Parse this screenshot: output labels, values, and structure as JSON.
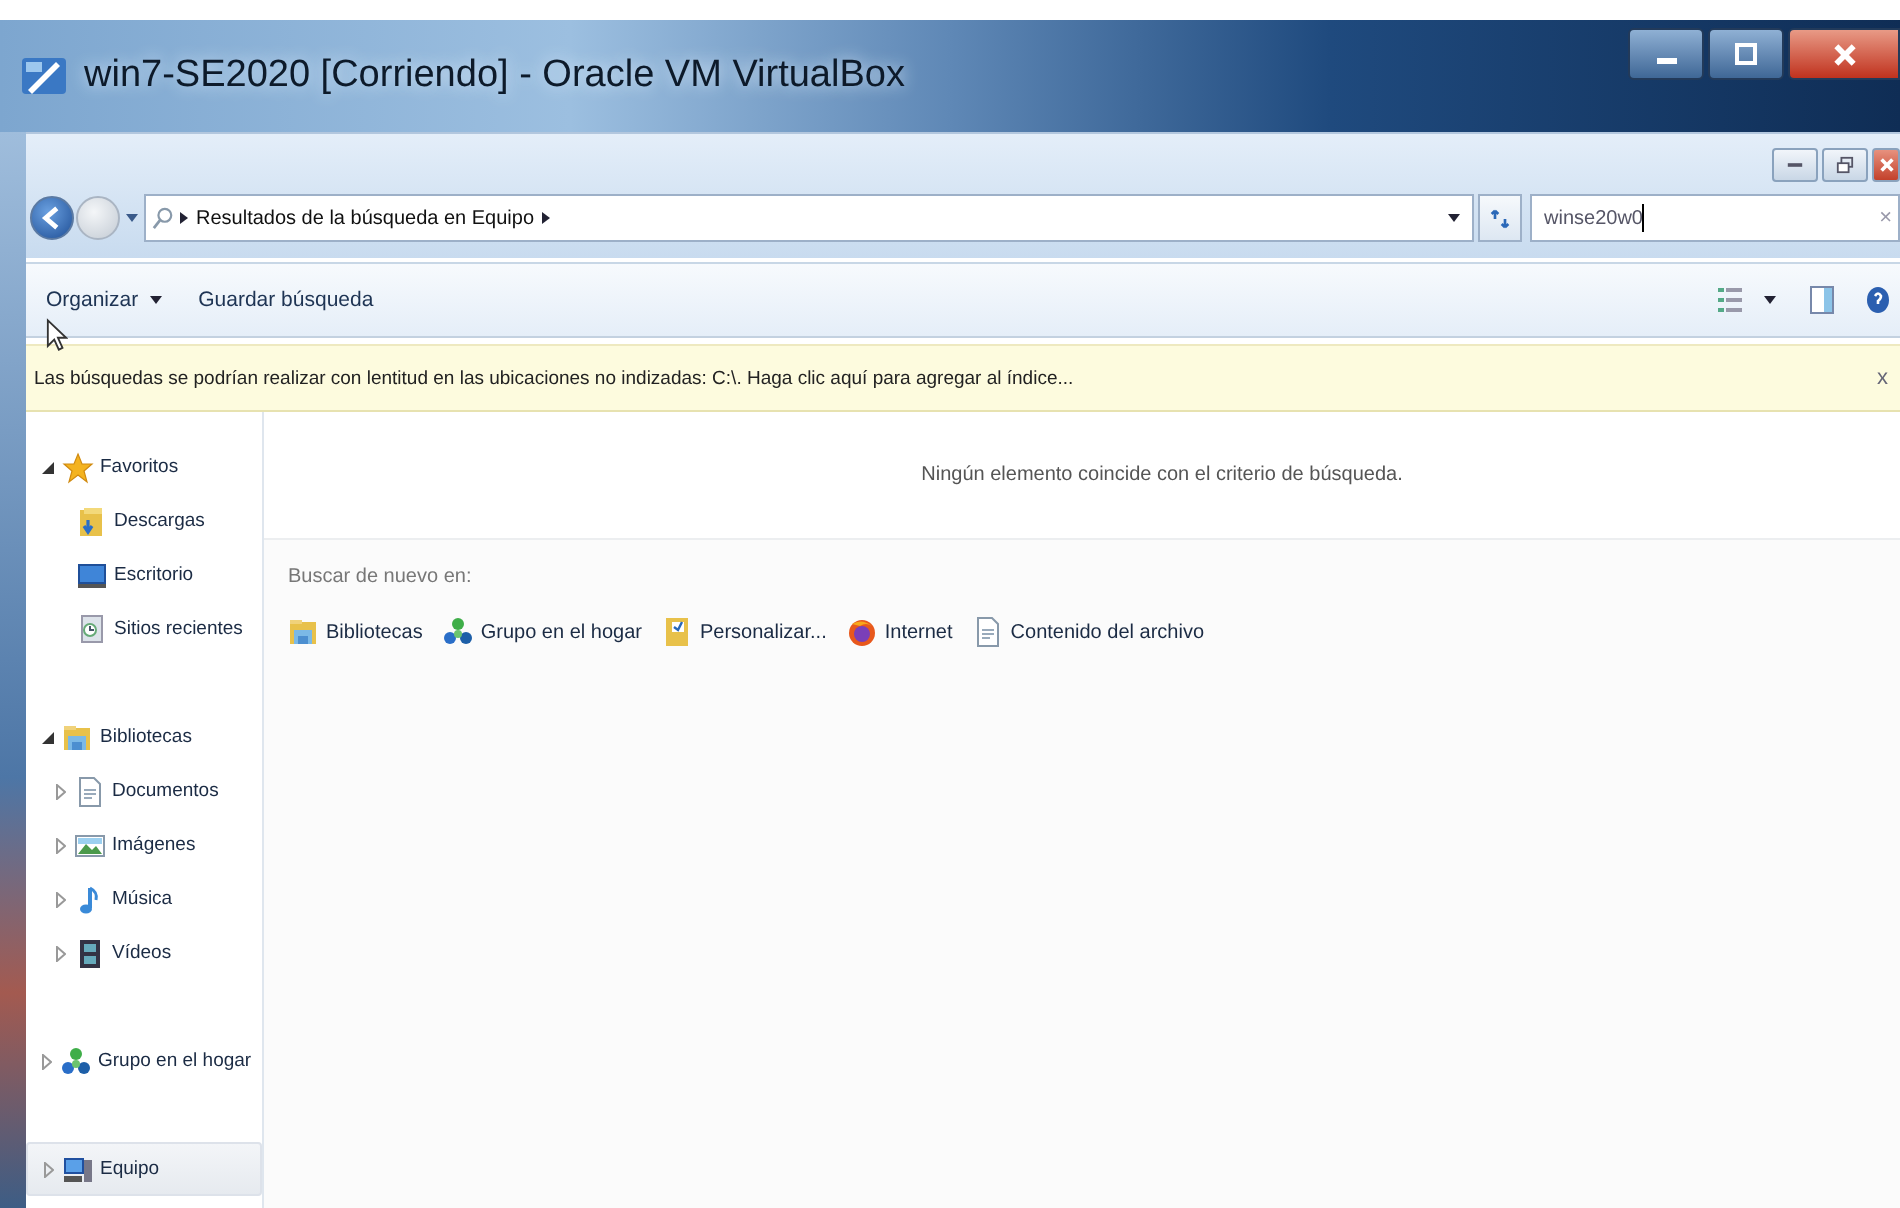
{
  "window": {
    "title": "win7-SE2020 [Corriendo] - Oracle VM VirtualBox"
  },
  "address_bar": {
    "breadcrumbs": [
      "Resultados de la búsqueda en Equipo"
    ]
  },
  "search": {
    "value": "winse20w0",
    "clear": "×"
  },
  "toolbar": {
    "items": [
      {
        "label": "Organizar",
        "dropdown": true
      },
      {
        "label": "Guardar búsqueda",
        "dropdown": false
      }
    ]
  },
  "info_bar": {
    "message": "Las búsquedas se podrían realizar con lentitud en las ubicaciones no indizadas: C:\\. Haga clic aquí para agregar al índice...",
    "close": "x"
  },
  "navigation": [
    {
      "label": "Favoritos",
      "kind": "star",
      "expanded": true,
      "selected": false,
      "children": [
        {
          "label": "Descargas",
          "kind": "downloads",
          "selected": false
        },
        {
          "label": "Escritorio",
          "kind": "desktop",
          "selected": false
        },
        {
          "label": "Sitios recientes",
          "kind": "recent",
          "selected": false
        }
      ]
    },
    {
      "label": "Bibliotecas",
      "kind": "library",
      "expanded": true,
      "selected": false,
      "children": [
        {
          "label": "Documentos",
          "kind": "document",
          "expanded": false,
          "selected": false
        },
        {
          "label": "Imágenes",
          "kind": "images",
          "expanded": false,
          "selected": false
        },
        {
          "label": "Música",
          "kind": "music",
          "expanded": false,
          "selected": false
        },
        {
          "label": "Vídeos",
          "kind": "video",
          "expanded": false,
          "selected": false
        }
      ]
    },
    {
      "label": "Grupo en el hogar",
      "kind": "homegroup",
      "expanded": false,
      "selected": false
    },
    {
      "label": "Equipo",
      "kind": "computer",
      "expanded": false,
      "selected": true
    }
  ],
  "results": {
    "empty_message": "Ningún elemento coincide con el criterio de búsqueda.",
    "search_again": {
      "label": "Buscar de nuevo en:",
      "locations": [
        {
          "label": "Bibliotecas",
          "kind": "library"
        },
        {
          "label": "Grupo en el hogar",
          "kind": "homegroup"
        },
        {
          "label": "Personalizar...",
          "kind": "custom"
        },
        {
          "label": "Internet",
          "kind": "internet"
        },
        {
          "label": "Contenido del archivo",
          "kind": "document"
        }
      ]
    }
  }
}
